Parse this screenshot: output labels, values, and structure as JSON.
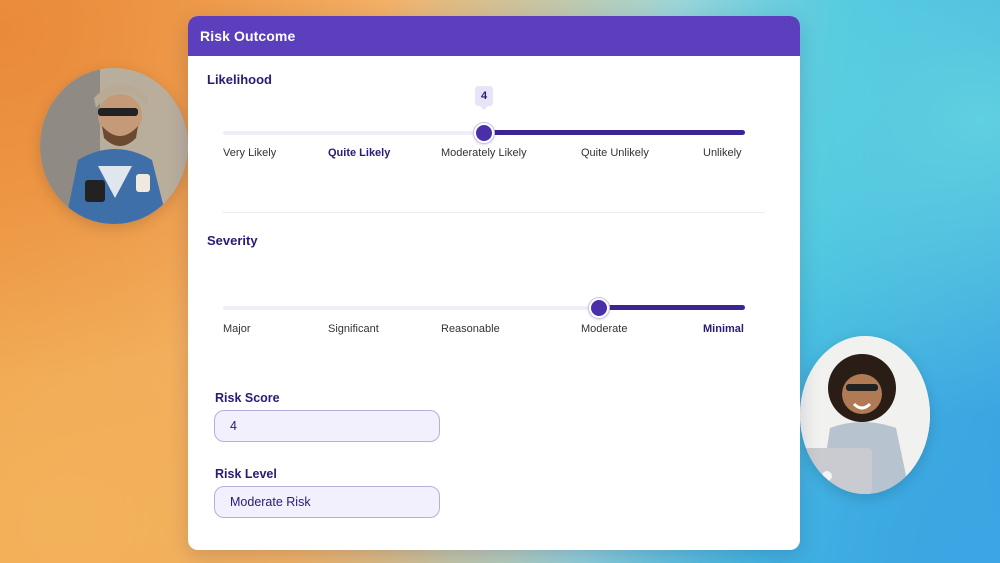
{
  "card": {
    "title": "Risk Outcome"
  },
  "likelihood": {
    "label": "Likelihood",
    "value": "4",
    "fill_fraction": 0.5,
    "options": [
      "Very Likely",
      "Quite Likely",
      "Moderately Likely",
      "Quite Unlikely",
      "Unlikely"
    ],
    "highlighted": "Quite Likely"
  },
  "severity": {
    "label": "Severity",
    "fill_fraction": 0.72,
    "options": [
      "Major",
      "Significant",
      "Reasonable",
      "Moderate",
      "Minimal"
    ],
    "highlighted": "Minimal"
  },
  "risk_score": {
    "label": "Risk Score",
    "value": "4"
  },
  "risk_level": {
    "label": "Risk Level",
    "value": "Moderate Risk"
  },
  "colors": {
    "header": "#5b3fbd",
    "accent": "#3d2494",
    "label": "#2b1a78"
  }
}
